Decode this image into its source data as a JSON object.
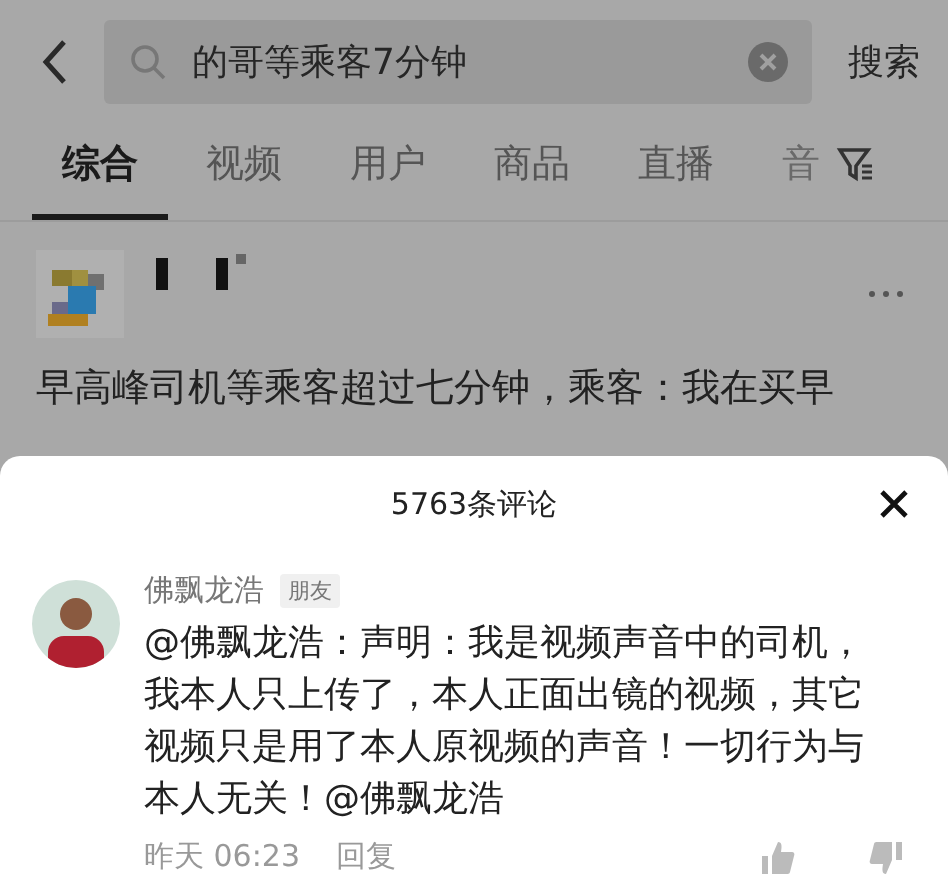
{
  "search": {
    "value": "的哥等乘客7分钟",
    "button": "搜索"
  },
  "tabs": [
    {
      "label": "综合",
      "selected": true
    },
    {
      "label": "视频",
      "selected": false
    },
    {
      "label": "用户",
      "selected": false
    },
    {
      "label": "商品",
      "selected": false
    },
    {
      "label": "直播",
      "selected": false
    },
    {
      "label": "音",
      "selected": false
    }
  ],
  "post": {
    "text": "早高峰司机等乘客超过七分钟，乘客：我在买早"
  },
  "comments_sheet": {
    "title": "5763条评论",
    "comments": [
      {
        "author": "佛飘龙浩",
        "badge": "朋友",
        "text": "@佛飘龙浩：声明：我是视频声音中的司机，我本人只上传了，本人正面出镜的视频，其它视频只是用了本人原视频的声音！一切行为与本人无关！@佛飘龙浩",
        "time": "昨天 06:23",
        "reply": "回复"
      }
    ]
  }
}
